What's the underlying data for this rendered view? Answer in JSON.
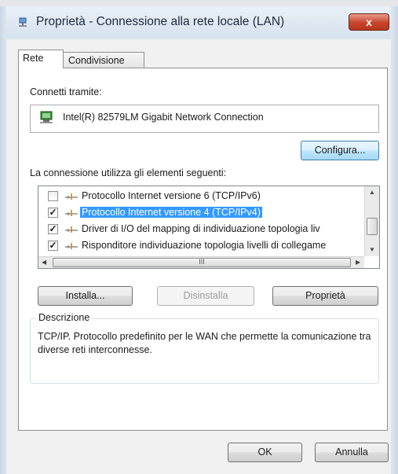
{
  "window": {
    "title": "Proprietà - Connessione alla rete locale (LAN)",
    "close_glyph": "x"
  },
  "tabs": [
    {
      "label": "Rete",
      "active": true
    },
    {
      "label": "Condivisione",
      "active": false
    }
  ],
  "connect_via": {
    "label": "Connetti tramite:",
    "adapter_name": "Intel(R) 82579LM Gigabit Network Connection",
    "adapter_icon": "network-adapter-icon"
  },
  "buttons": {
    "configure": "Configura...",
    "install": "Installa...",
    "uninstall": "Disinstalla",
    "properties": "Proprietà",
    "ok": "OK",
    "cancel": "Annulla"
  },
  "items_label": "La connessione utilizza gli elementi seguenti:",
  "items": [
    {
      "label": "Protocollo Internet versione 6 (TCP/IPv6)",
      "checked": false,
      "selected": false,
      "icon": "protocol-icon"
    },
    {
      "label": "Protocollo Internet versione 4 (TCP/IPv4)",
      "checked": true,
      "selected": true,
      "icon": "protocol-icon"
    },
    {
      "label": "Driver di I/O del mapping di individuazione topologia liv",
      "checked": true,
      "selected": false,
      "icon": "protocol-icon"
    },
    {
      "label": "Risponditore individuazione topologia livelli di collegame",
      "checked": true,
      "selected": false,
      "icon": "protocol-icon"
    }
  ],
  "scroll_grip": "III",
  "description": {
    "title": "Descrizione",
    "text": "TCP/IP. Protocollo predefinito per le WAN che permette la comunicazione tra diverse reti interconnesse."
  },
  "colors": {
    "selection": "#3399ff",
    "close_button": "#c7442c",
    "focus_border": "#3c7fb1"
  }
}
